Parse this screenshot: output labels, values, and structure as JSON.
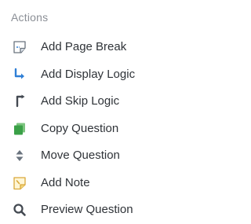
{
  "actions_panel": {
    "title": "Actions",
    "items": [
      {
        "label": "Add Page Break",
        "icon": "page-break-icon",
        "icon_color": "#5a6470"
      },
      {
        "label": "Add Display Logic",
        "icon": "display-logic-icon",
        "icon_color": "#2f7fd6"
      },
      {
        "label": "Add Skip Logic",
        "icon": "skip-logic-icon",
        "icon_color": "#444a52"
      },
      {
        "label": "Copy Question",
        "icon": "copy-icon",
        "icon_color": "#3aa047"
      },
      {
        "label": "Move Question",
        "icon": "move-icon",
        "icon_color": "#5a6470"
      },
      {
        "label": "Add Note",
        "icon": "note-icon",
        "icon_color": "#e0b84a"
      },
      {
        "label": "Preview Question",
        "icon": "preview-icon",
        "icon_color": "#444a52"
      }
    ]
  }
}
